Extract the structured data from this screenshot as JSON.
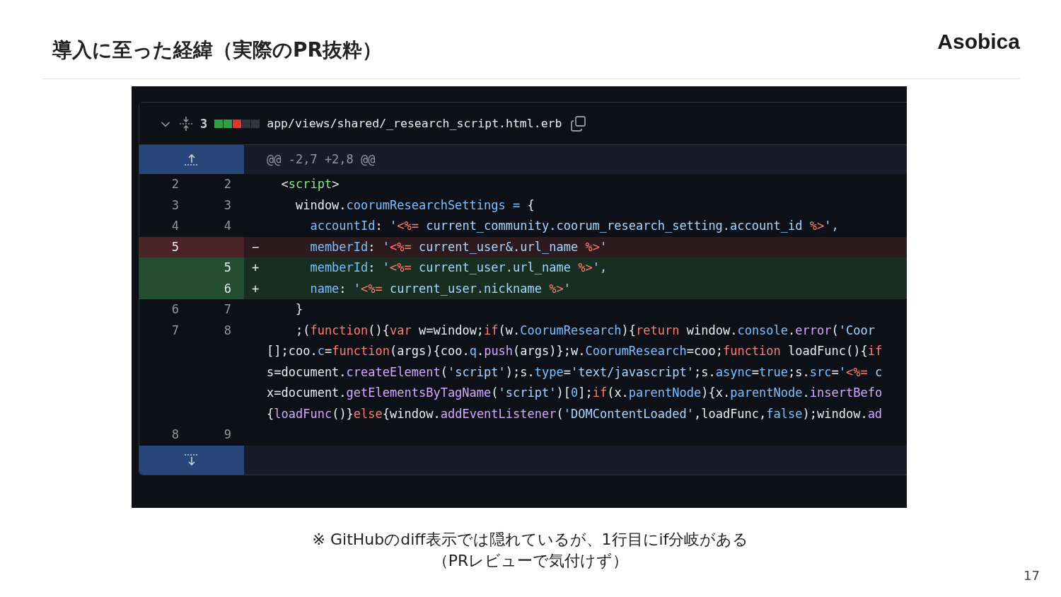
{
  "slide": {
    "title": "導入に至った経緯（実際のPR抜粋）",
    "logo": "Asobica",
    "page_number": "17",
    "caption_lines": [
      "※ GitHubのdiff表示では隠れているが、1行目にif分岐がある",
      "（PRレビューで気付けず）"
    ]
  },
  "diff": {
    "expanded": true,
    "changes": "3",
    "diffstat": [
      {
        "kind": "add"
      },
      {
        "kind": "add"
      },
      {
        "kind": "del"
      },
      {
        "kind": "none"
      },
      {
        "kind": "none"
      }
    ],
    "file_path": "app/views/shared/_research_script.html.erb",
    "hunk_header": "@@ -2,7 +2,8 @@",
    "lines": [
      {
        "kind": "context",
        "old": "2",
        "new": "2",
        "tokens": [
          {
            "text": "  <",
            "kind": "plain"
          },
          {
            "text": "script",
            "kind": "tag"
          },
          {
            "text": ">",
            "kind": "plain"
          }
        ]
      },
      {
        "kind": "context",
        "old": "3",
        "new": "3",
        "tokens": [
          {
            "text": "    window.",
            "kind": "plain"
          },
          {
            "text": "coorumResearchSettings = ",
            "kind": "prop"
          },
          {
            "text": "{",
            "kind": "plain"
          }
        ]
      },
      {
        "kind": "context",
        "old": "4",
        "new": "4",
        "tokens": [
          {
            "text": "      accountId",
            "kind": "prop"
          },
          {
            "text": ": ",
            "kind": "plain"
          },
          {
            "text": "'",
            "kind": "str"
          },
          {
            "text": "<%=",
            "kind": "erb"
          },
          {
            "text": " current_community.coorum_research_setting.account_id ",
            "kind": "str"
          },
          {
            "text": "%>",
            "kind": "erb"
          },
          {
            "text": "',",
            "kind": "str"
          }
        ]
      },
      {
        "kind": "del",
        "old": "5",
        "sign": "−",
        "tokens": [
          {
            "text": "      memberId",
            "kind": "prop"
          },
          {
            "text": ": ",
            "kind": "plain"
          },
          {
            "text": "'",
            "kind": "str"
          },
          {
            "text": "<%=",
            "kind": "erb"
          },
          {
            "text": " current_user&.url_name ",
            "kind": "str"
          },
          {
            "text": "%>",
            "kind": "erb"
          },
          {
            "text": "'",
            "kind": "str"
          }
        ]
      },
      {
        "kind": "add",
        "new": "5",
        "sign": "+",
        "tokens": [
          {
            "text": "      memberId",
            "kind": "prop"
          },
          {
            "text": ": ",
            "kind": "plain"
          },
          {
            "text": "'",
            "kind": "str"
          },
          {
            "text": "<%=",
            "kind": "erb"
          },
          {
            "text": " current_user.url_name ",
            "kind": "str"
          },
          {
            "text": "%>",
            "kind": "erb"
          },
          {
            "text": "',",
            "kind": "str"
          }
        ]
      },
      {
        "kind": "add",
        "new": "6",
        "sign": "+",
        "tokens": [
          {
            "text": "      name",
            "kind": "prop"
          },
          {
            "text": ": ",
            "kind": "plain"
          },
          {
            "text": "'",
            "kind": "str"
          },
          {
            "text": "<%=",
            "kind": "erb"
          },
          {
            "text": " current_user.nickname ",
            "kind": "str"
          },
          {
            "text": "%>",
            "kind": "erb"
          },
          {
            "text": "'",
            "kind": "str"
          }
        ]
      },
      {
        "kind": "context",
        "old": "6",
        "new": "7",
        "tokens": [
          {
            "text": "    }",
            "kind": "plain"
          }
        ]
      },
      {
        "kind": "context",
        "old": "7",
        "new": "8",
        "tokens": [
          {
            "text": "    ;(",
            "kind": "plain"
          },
          {
            "text": "function",
            "kind": "kw"
          },
          {
            "text": "(){",
            "kind": "plain"
          },
          {
            "text": "var",
            "kind": "kw"
          },
          {
            "text": " w=window;",
            "kind": "plain"
          },
          {
            "text": "if",
            "kind": "kw"
          },
          {
            "text": "(w.",
            "kind": "plain"
          },
          {
            "text": "CoorumResearch",
            "kind": "prop"
          },
          {
            "text": "){",
            "kind": "plain"
          },
          {
            "text": "return",
            "kind": "kw"
          },
          {
            "text": " window.",
            "kind": "plain"
          },
          {
            "text": "console",
            "kind": "prop"
          },
          {
            "text": ".",
            "kind": "plain"
          },
          {
            "text": "error",
            "kind": "fn"
          },
          {
            "text": "(",
            "kind": "plain"
          },
          {
            "text": "'Coor",
            "kind": "str"
          },
          {
            "kind": "break"
          },
          {
            "text": "[];coo.",
            "kind": "plain"
          },
          {
            "text": "c",
            "kind": "prop"
          },
          {
            "text": "=",
            "kind": "plain"
          },
          {
            "text": "function",
            "kind": "kw"
          },
          {
            "text": "(args){coo.",
            "kind": "plain"
          },
          {
            "text": "q",
            "kind": "prop"
          },
          {
            "text": ".",
            "kind": "plain"
          },
          {
            "text": "push",
            "kind": "fn"
          },
          {
            "text": "(args)};w.",
            "kind": "plain"
          },
          {
            "text": "CoorumResearch",
            "kind": "prop"
          },
          {
            "text": "=coo;",
            "kind": "plain"
          },
          {
            "text": "function",
            "kind": "kw"
          },
          {
            "text": " loadFunc(){",
            "kind": "plain"
          },
          {
            "text": "if",
            "kind": "kw"
          },
          {
            "kind": "break"
          },
          {
            "text": "s=document.",
            "kind": "plain"
          },
          {
            "text": "createElement",
            "kind": "fn"
          },
          {
            "text": "(",
            "kind": "plain"
          },
          {
            "text": "'script'",
            "kind": "str"
          },
          {
            "text": ");s.",
            "kind": "plain"
          },
          {
            "text": "type",
            "kind": "prop"
          },
          {
            "text": "=",
            "kind": "plain"
          },
          {
            "text": "'text/javascript'",
            "kind": "str"
          },
          {
            "text": ";s.",
            "kind": "plain"
          },
          {
            "text": "async",
            "kind": "prop"
          },
          {
            "text": "=",
            "kind": "plain"
          },
          {
            "text": "true",
            "kind": "prop"
          },
          {
            "text": ";s.",
            "kind": "plain"
          },
          {
            "text": "src",
            "kind": "prop"
          },
          {
            "text": "=",
            "kind": "plain"
          },
          {
            "text": "'",
            "kind": "str"
          },
          {
            "text": "<%=",
            "kind": "erb"
          },
          {
            "text": " c",
            "kind": "str"
          },
          {
            "kind": "break"
          },
          {
            "text": "x=document.",
            "kind": "plain"
          },
          {
            "text": "getElementsByTagName",
            "kind": "fn"
          },
          {
            "text": "(",
            "kind": "plain"
          },
          {
            "text": "'script'",
            "kind": "str"
          },
          {
            "text": ")[",
            "kind": "plain"
          },
          {
            "text": "0",
            "kind": "prop"
          },
          {
            "text": "];",
            "kind": "plain"
          },
          {
            "text": "if",
            "kind": "kw"
          },
          {
            "text": "(x.",
            "kind": "plain"
          },
          {
            "text": "parentNode",
            "kind": "prop"
          },
          {
            "text": "){x.",
            "kind": "plain"
          },
          {
            "text": "parentNode",
            "kind": "prop"
          },
          {
            "text": ".",
            "kind": "plain"
          },
          {
            "text": "insertBefo",
            "kind": "fn"
          },
          {
            "kind": "break"
          },
          {
            "text": "{",
            "kind": "plain"
          },
          {
            "text": "loadFunc",
            "kind": "fn"
          },
          {
            "text": "()}",
            "kind": "plain"
          },
          {
            "text": "else",
            "kind": "kw"
          },
          {
            "text": "{window.",
            "kind": "plain"
          },
          {
            "text": "addEventListener",
            "kind": "fn"
          },
          {
            "text": "(",
            "kind": "plain"
          },
          {
            "text": "'DOMContentLoaded'",
            "kind": "str"
          },
          {
            "text": ",loadFunc,",
            "kind": "plain"
          },
          {
            "text": "false",
            "kind": "prop"
          },
          {
            "text": ");window.",
            "kind": "plain"
          },
          {
            "text": "ad",
            "kind": "fn"
          }
        ]
      },
      {
        "kind": "context",
        "old": "8",
        "new": "9"
      }
    ]
  }
}
